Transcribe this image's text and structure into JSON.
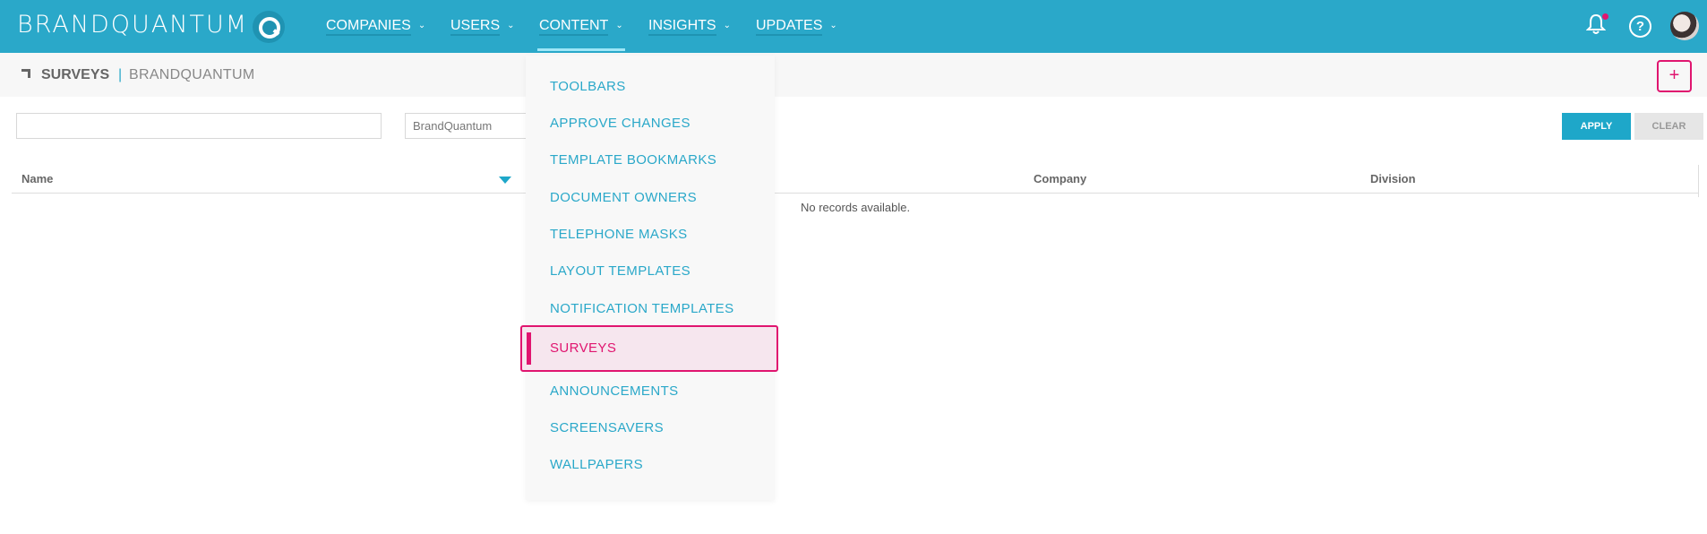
{
  "brand": {
    "name": "BRANDQUANTUM"
  },
  "nav": {
    "items": [
      {
        "label": "COMPANIES"
      },
      {
        "label": "USERS"
      },
      {
        "label": "CONTENT"
      },
      {
        "label": "INSIGHTS"
      },
      {
        "label": "UPDATES"
      }
    ],
    "active": "CONTENT"
  },
  "header_icons": [
    "bell-icon",
    "help-icon",
    "avatar"
  ],
  "breadcrumb": {
    "main": "SURVEYS",
    "separator": "|",
    "sub": "BRANDQUANTUM"
  },
  "add_button": {
    "label": "+"
  },
  "filters": {
    "name_value": "",
    "company_value": "BrandQuantum"
  },
  "buttons": {
    "apply": "APPLY",
    "clear": "CLEAR"
  },
  "table": {
    "columns": [
      "Name",
      "Company",
      "Division"
    ],
    "empty_message": "No records available."
  },
  "content_menu": {
    "items": [
      "TOOLBARS",
      "APPROVE CHANGES",
      "TEMPLATE BOOKMARKS",
      "DOCUMENT OWNERS",
      "TELEPHONE MASKS",
      "LAYOUT TEMPLATES",
      "NOTIFICATION TEMPLATES",
      "SURVEYS",
      "ANNOUNCEMENTS",
      "SCREENSAVERS",
      "WALLPAPERS"
    ],
    "selected": "SURVEYS"
  },
  "colors": {
    "primary": "#2aa8c9",
    "accent": "#e0156f",
    "active_bg": "#f6e6ee"
  }
}
